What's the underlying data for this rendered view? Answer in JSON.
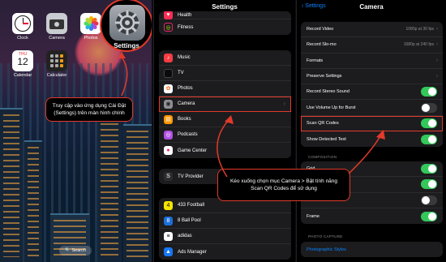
{
  "home": {
    "apps": [
      {
        "label": "Clock",
        "icon": "clock-icon"
      },
      {
        "label": "Camera",
        "icon": "camera-icon"
      },
      {
        "label": "Photos",
        "icon": "photos-icon"
      },
      {
        "label": "Calendar",
        "icon": "calendar-icon",
        "dow": "THU",
        "day": "12"
      },
      {
        "label": "Calculator",
        "icon": "calculator-icon"
      }
    ],
    "settings_zoom_label": "Settings",
    "callout": "Truy cập vào ứng dụng Cài Đặt (Settings) trên màn hình chính",
    "search_label": "🔍 Search"
  },
  "settings": {
    "title": "Settings",
    "group1": [
      {
        "label": "Health",
        "color": "#ff2d55",
        "icon": "health-icon",
        "glyph": "♥"
      },
      {
        "label": "Fitness",
        "color": "#1c1c1e",
        "icon": "fitness-icon",
        "glyph": "◎"
      }
    ],
    "group2": [
      {
        "label": "Music",
        "color": "#fc3c44",
        "icon": "music-icon",
        "glyph": "♪"
      },
      {
        "label": "TV",
        "color": "#0a0a0a",
        "icon": "tv-icon",
        "glyph": ""
      },
      {
        "label": "Photos",
        "color": "#ffffff",
        "icon": "photos-icon",
        "glyph": "✿"
      },
      {
        "label": "Camera",
        "color": "#8e8e93",
        "icon": "camera-icon",
        "glyph": "◉"
      },
      {
        "label": "Books",
        "color": "#ff9500",
        "icon": "books-icon",
        "glyph": "▤"
      },
      {
        "label": "Podcasts",
        "color": "#b150e2",
        "icon": "podcasts-icon",
        "glyph": "◎"
      },
      {
        "label": "Game Center",
        "color": "#ffffff",
        "icon": "game-center-icon",
        "glyph": "●"
      }
    ],
    "group3": [
      {
        "label": "TV Provider",
        "color": "#2c2c2e",
        "icon": "tv-provider-icon",
        "glyph": "S"
      }
    ],
    "group4": [
      {
        "label": "433 Football",
        "color": "#f5e400",
        "icon": "433-football-icon",
        "glyph": "4"
      },
      {
        "label": "8 Ball Pool",
        "color": "#1d6fd8",
        "icon": "8-ball-pool-icon",
        "glyph": "8"
      },
      {
        "label": "adidas",
        "color": "#ffffff",
        "icon": "adidas-icon",
        "glyph": "≡"
      },
      {
        "label": "Ads Manager",
        "color": "#1877f2",
        "icon": "ads-manager-icon",
        "glyph": "▲"
      }
    ],
    "callout": "Kéo xuống chọn mục Camera > Bật tính năng Scan QR Codes để sử dụng"
  },
  "camera": {
    "back_label": "Settings",
    "title": "Camera",
    "rows": [
      {
        "label": "Record Video",
        "value": "1080p at 30 fps",
        "kind": "nav"
      },
      {
        "label": "Record Slo-mo",
        "value": "1080p at 240 fps",
        "kind": "nav"
      },
      {
        "label": "Formats",
        "value": "",
        "kind": "nav"
      },
      {
        "label": "Preserve Settings",
        "value": "",
        "kind": "nav"
      },
      {
        "label": "Record Stereo Sound",
        "value": "",
        "kind": "toggle",
        "on": true
      },
      {
        "label": "Use Volume Up for Burst",
        "value": "",
        "kind": "toggle",
        "on": false
      },
      {
        "label": "Scan QR Codes",
        "value": "",
        "kind": "toggle",
        "on": true
      },
      {
        "label": "Show Detected Text",
        "value": "",
        "kind": "toggle",
        "on": true
      }
    ],
    "composition_header": "COMPOSITION",
    "composition_rows": [
      {
        "label": "Grid",
        "on": true
      },
      {
        "label": "",
        "on": true
      },
      {
        "label": "Camera",
        "on": false
      },
      {
        "label": "Frame",
        "on": true
      }
    ],
    "photo_capture_header": "PHOTO CAPTURE",
    "photographic_styles": "Photographic Styles"
  }
}
